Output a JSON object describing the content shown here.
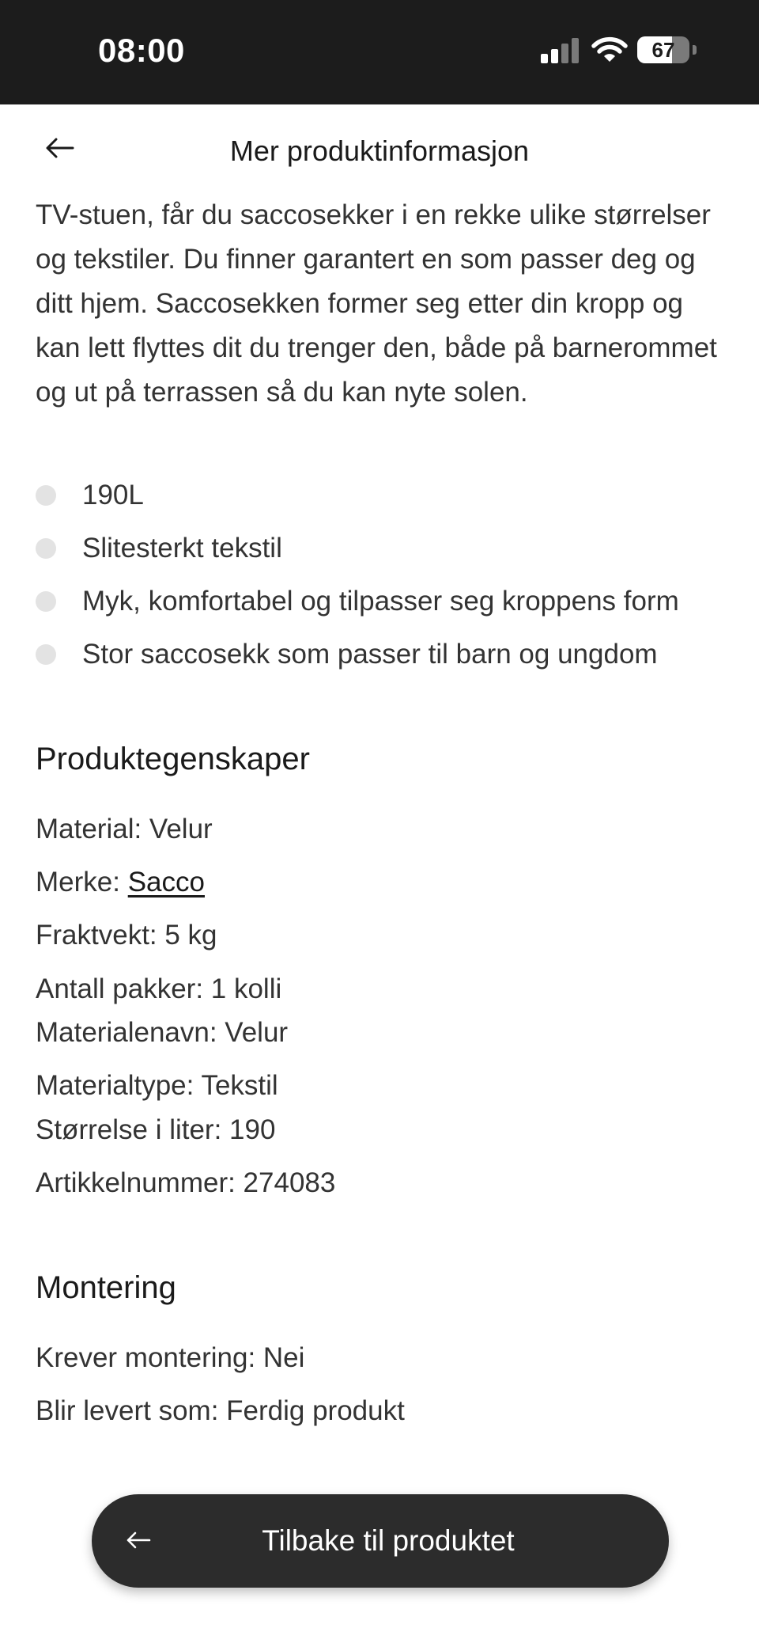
{
  "status_bar": {
    "time": "08:00",
    "battery_level": "67",
    "battery_fraction": 0.67,
    "signal_bars": 2,
    "signal_max": 4,
    "colors": {
      "background": "#1c1c1c",
      "foreground": "#ffffff",
      "inactive": "#7a7a7a"
    }
  },
  "header": {
    "title": "Mer produktinformasjon",
    "back_icon": "arrow-left-icon"
  },
  "description": "TV-stuen, får du saccosekker i en rekke ulike størrelser og tekstiler. Du finner garantert en som passer deg og ditt hjem. Saccosekken former seg etter din kropp og kan lett flyttes dit du trenger den, både på barnerommet og ut på terrassen så du kan nyte solen.",
  "features": [
    "190L",
    "Slitesterkt tekstil",
    "Myk, komfortabel og tilpasser seg kroppens form",
    "Stor saccosekk som passer til barn og ungdom"
  ],
  "properties": {
    "heading": "Produktegenskaper",
    "material": "Material: Velur",
    "brand_prefix": "Merke: ",
    "brand_name": "Sacco",
    "shipping_weight": "Fraktvekt: 5 kg",
    "package_count": "Antall pakker: 1 kolli",
    "material_name": "Materialenavn: Velur",
    "material_type": "Materialtype: Tekstil",
    "size_liters": "Størrelse i liter: 190",
    "article_number": "Artikkelnummer: 274083"
  },
  "assembly": {
    "heading": "Montering",
    "requires_assembly": "Krever montering: Nei",
    "delivered_as": "Blir levert som: Ferdig produkt"
  },
  "footer_button": {
    "label": "Tilbake til produktet",
    "icon": "arrow-left-icon",
    "background": "#2c2c2c"
  }
}
